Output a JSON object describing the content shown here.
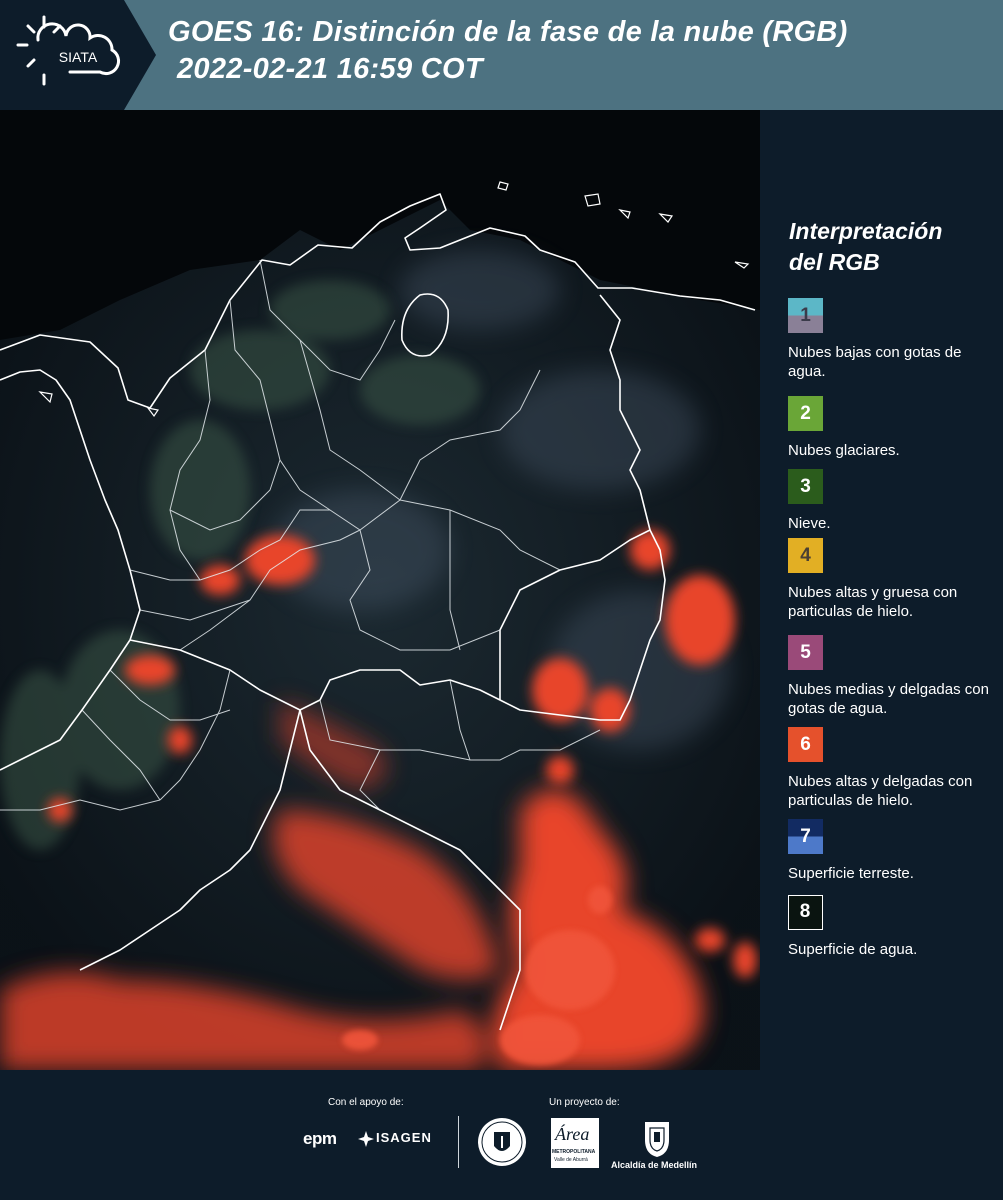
{
  "header": {
    "title_line1": "GOES 16: Distinción de la fase de la nube (RGB)",
    "title_line2": "2022-02-21 16:59 COT",
    "logo_text": "SIATA",
    "background_color": "#4d7281"
  },
  "map": {
    "icon": "satellite-rgb-map-colombia",
    "land_border_color": "#ffffff",
    "background_color": "#05080c"
  },
  "legend": {
    "title_line1": "Interpretación",
    "title_line2": "del RGB",
    "items": [
      {
        "number": "1",
        "label": "Nubes bajas con gotas de agua.",
        "color_top": "#5cb7c7",
        "color_bottom": "#8a8097",
        "number_color": "#3b3b4a"
      },
      {
        "number": "2",
        "label": "Nubes glaciares.",
        "color_top": "#6aa637",
        "color_bottom": "#6aa637",
        "number_color": "#ffffff"
      },
      {
        "number": "3",
        "label": "Nieve.",
        "color_top": "#2b5c1c",
        "color_bottom": "#2b5c1c",
        "number_color": "#ffffff"
      },
      {
        "number": "4",
        "label": "Nubes altas y gruesa con particulas de hielo.",
        "color_top": "#e2af24",
        "color_bottom": "#e2af24",
        "number_color": "#4a4033"
      },
      {
        "number": "5",
        "label": "Nubes medias y delgadas con gotas de agua.",
        "color_top": "#9a4a79",
        "color_bottom": "#9a4a79",
        "number_color": "#ffffff"
      },
      {
        "number": "6",
        "label": "Nubes altas y delgadas con particulas de hielo.",
        "color_top": "#e5512c",
        "color_bottom": "#e5512c",
        "number_color": "#ffffff"
      },
      {
        "number": "7",
        "label": "Superficie terreste.",
        "color_top": "#122b62",
        "color_bottom": "#4d79c9",
        "number_color": "#ffffff"
      },
      {
        "number": "8",
        "label": "Superficie de agua.",
        "color_top": "#0a1410",
        "color_bottom": "#0a1410",
        "number_color": "#ffffff"
      }
    ]
  },
  "footer": {
    "support_label": "Con el apoyo de:",
    "project_label": "Un proyecto de:",
    "epm": "epm",
    "isagen": "ISAGEN",
    "area_metro": "Área",
    "area_metro_sub": "METROPOLITANA",
    "area_metro_sub2": "Valle de Aburrá",
    "alcaldia": "Alcaldía de Medellín"
  }
}
